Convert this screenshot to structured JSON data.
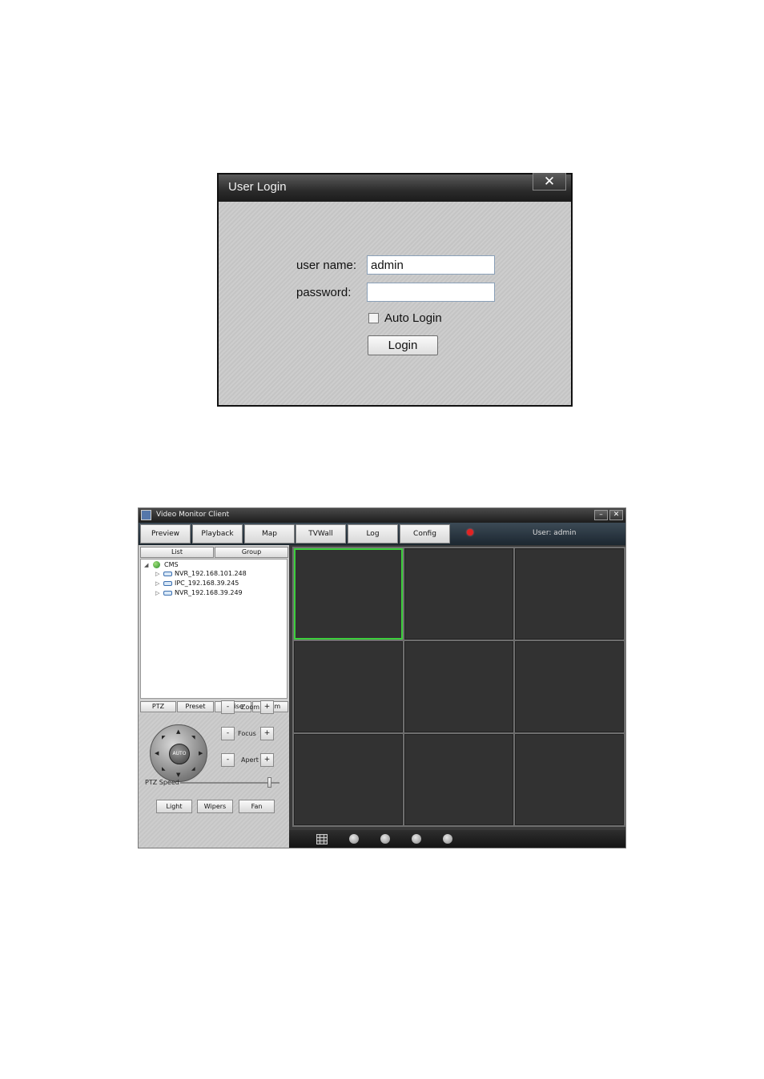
{
  "login": {
    "title": "User Login",
    "close_glyph": "✕",
    "username_label": "user name:",
    "username_value": "admin",
    "password_label": "password:",
    "password_value": "",
    "auto_login_label": "Auto Login",
    "auto_login_checked": false,
    "login_button": "Login"
  },
  "client": {
    "title": "Video Monitor Client",
    "minimize_glyph": "–",
    "close_glyph": "✕",
    "tabs": [
      "Preview",
      "Playback",
      "Map",
      "TVWall",
      "Log",
      "Config"
    ],
    "user_label": "User: admin",
    "alarm_color": "#e22222",
    "list_tabs": [
      "List",
      "Group"
    ],
    "tree": {
      "root": "CMS",
      "devices": [
        "NVR_192.168.101.248",
        "IPC_192.168.39.245",
        "NVR_192.168.39.249"
      ]
    },
    "ptz_tabs": [
      "PTZ",
      "Preset",
      "Cruise",
      "Param"
    ],
    "joystick_label": "AUTO",
    "controls": [
      {
        "label": "Zoom",
        "minus": "-",
        "plus": "+"
      },
      {
        "label": "Focus",
        "minus": "-",
        "plus": "+"
      },
      {
        "label": "Apert",
        "minus": "-",
        "plus": "+"
      }
    ],
    "ptz_speed_label": "PTZ Speed",
    "ptz_speed_level": 0.9,
    "bottom_buttons": [
      "Light",
      "Wipers",
      "Fan"
    ],
    "grid_rows": 3,
    "grid_cols": 3,
    "selected_cell": 0,
    "selected_color": "#3ccf3c",
    "toolbar_icons": [
      "grid-layout-icon",
      "fullscreen-icon",
      "prev-page-icon",
      "next-page-icon",
      "stop-icon"
    ]
  }
}
